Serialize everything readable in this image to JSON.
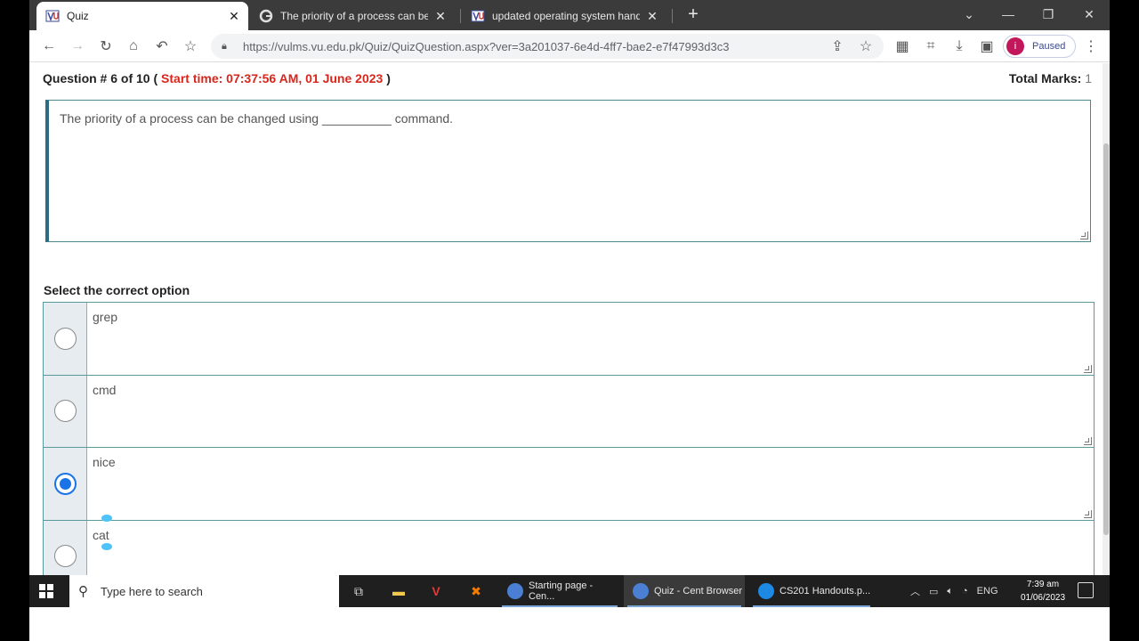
{
  "browser": {
    "tabs": [
      {
        "title": "Quiz",
        "active": true
      },
      {
        "title": "The priority of a process can be c",
        "active": false
      },
      {
        "title": "updated operating system hando",
        "active": false
      }
    ],
    "url": "https://vulms.vu.edu.pk/Quiz/QuizQuestion.aspx?ver=3a201037-6e4d-4ff7-bae2-e7f47993d3c3",
    "profile_initial": "i",
    "profile_status": "Paused"
  },
  "quiz": {
    "question_number": "Question # 6 of 10",
    "start_time_label": "Start time: 07:37:56 AM, 01 June 2023",
    "total_marks_label": "Total Marks:",
    "total_marks_value": "1",
    "question_text": "The priority of a process can be changed using __________ command.",
    "select_label": "Select the correct option",
    "options": [
      {
        "label": "grep",
        "selected": false
      },
      {
        "label": "cmd",
        "selected": false
      },
      {
        "label": "nice",
        "selected": true
      },
      {
        "label": "cat",
        "selected": false
      }
    ]
  },
  "taskbar": {
    "search_placeholder": "Type here to search",
    "apps": [
      {
        "label": "Starting page - Cen..."
      },
      {
        "label": "Quiz - Cent Browser"
      },
      {
        "label": "CS201 Handouts.p..."
      }
    ],
    "language": "ENG",
    "time": "7:39 am",
    "date": "01/06/2023"
  },
  "colors": {
    "accent_radio": "#1a73e8",
    "start_time_red": "#d9261c",
    "border_teal": "#5a9a9a"
  }
}
